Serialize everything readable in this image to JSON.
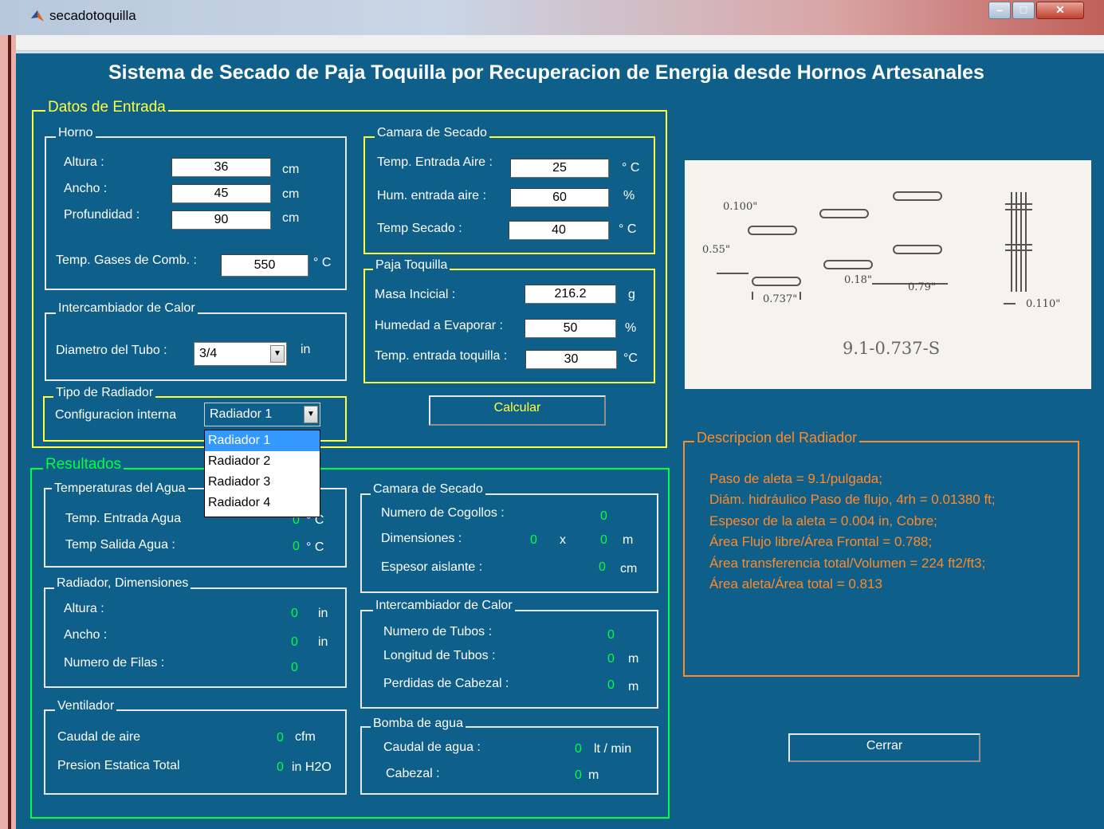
{
  "window": {
    "title": "secadotoquilla"
  },
  "header": {
    "title": "Sistema de Secado de Paja Toquilla por Recuperacion de Energia desde Hornos Artesanales"
  },
  "entrada": {
    "label": "Datos de Entrada",
    "horno": {
      "label": "Horno",
      "altura_label": "Altura :",
      "altura_value": "36",
      "altura_unit": "cm",
      "ancho_label": "Ancho :",
      "ancho_value": "45",
      "ancho_unit": "cm",
      "prof_label": "Profundidad :",
      "prof_value": "90",
      "prof_unit": "cm",
      "gases_label": "Temp. Gases de Comb. :",
      "gases_value": "550",
      "gases_unit": "° C"
    },
    "camara": {
      "label": "Camara de Secado",
      "temp_aire_label": "Temp. Entrada Aire :",
      "temp_aire_value": "25",
      "temp_aire_unit": "° C",
      "hum_label": "Hum. entrada aire :",
      "hum_value": "60",
      "hum_unit": "%",
      "temp_sec_label": "Temp Secado :",
      "temp_sec_value": "40",
      "temp_sec_unit": "° C"
    },
    "intercambiador": {
      "label": "Intercambiador de Calor",
      "diam_label": "Diametro del Tubo :",
      "diam_value": "3/4",
      "diam_unit": "in"
    },
    "paja": {
      "label": "Paja Toquilla",
      "masa_label": "Masa Incicial :",
      "masa_value": "216.2",
      "masa_unit": "g",
      "humedad_label": "Humedad a Evaporar :",
      "humedad_value": "50",
      "humedad_unit": "%",
      "temp_label": "Temp. entrada toquilla :",
      "temp_value": "30",
      "temp_unit": "°C"
    },
    "radiador": {
      "label": "Tipo de Radiador",
      "config_label": "Configuracion interna",
      "selected": "Radiador 1",
      "options": [
        "Radiador 1",
        "Radiador 2",
        "Radiador 3",
        "Radiador 4"
      ]
    },
    "calcular_label": "Calcular"
  },
  "resultados": {
    "label": "Resultados",
    "temp_agua": {
      "label": "Temperaturas del Agua",
      "entrada_label": "Temp. Entrada Agua",
      "entrada_value": "0",
      "entrada_unit": "° C",
      "salida_label": "Temp Salida Agua :",
      "salida_value": "0",
      "salida_unit": "° C"
    },
    "radiador_dim": {
      "label": "Radiador, Dimensiones",
      "altura_label": "Altura :",
      "altura_value": "0",
      "altura_unit": "in",
      "ancho_label": "Ancho :",
      "ancho_value": "0",
      "ancho_unit": "in",
      "filas_label": "Numero de Filas :",
      "filas_value": "0"
    },
    "ventilador": {
      "label": "Ventilador",
      "caudal_label": "Caudal  de aire",
      "caudal_value": "0",
      "caudal_unit": "cfm",
      "presion_label": "Presion Estatica Total",
      "presion_value": "0",
      "presion_unit": "in H2O"
    },
    "camara": {
      "label": "Camara de Secado",
      "cogollos_label": "Numero de Cogollos :",
      "cogollos_value": "0",
      "dim_label": "Dimensiones :",
      "dim_a": "0",
      "dim_x": "x",
      "dim_b": "0",
      "dim_unit": "m",
      "espesor_label": "Espesor aislante :",
      "espesor_value": "0",
      "espesor_unit": "cm"
    },
    "intercambiador": {
      "label": "Intercambiador de Calor",
      "tubos_label": "Numero de Tubos :",
      "tubos_value": "0",
      "longitud_label": "Longitud de Tubos :",
      "longitud_value": "0",
      "longitud_unit": "m",
      "perdidas_label": "Perdidas de Cabezal :",
      "perdidas_value": "0",
      "perdidas_unit": "m"
    },
    "bomba": {
      "label": "Bomba de agua",
      "caudal_label": "Caudal  de agua :",
      "caudal_value": "0",
      "caudal_unit": "lt / min",
      "cabezal_label": "Cabezal :",
      "cabezal_value": "0",
      "cabezal_unit": "m"
    }
  },
  "schematic": {
    "l1": "0.100\"",
    "l2": "0.55\"",
    "l3": "0.18\"",
    "l4": "0.79\"",
    "l5": "0.737\"",
    "l6": "0.110\"",
    "caption": "9.1-0.737-S"
  },
  "descripcion": {
    "label": "Descripcion del Radiador",
    "lines": [
      "Paso de aleta = 9.1/pulgada;",
      "Diám. hidráulico Paso de flujo, 4rh = 0.01380 ft;",
      "Espesor de la aleta = 0.004 in, Cobre;",
      "Área Flujo libre/Área Frontal = 0.788;",
      "Área transferencia total/Volumen = 224 ft2/ft3;",
      "Área aleta/Área total = 0.813"
    ]
  },
  "cerrar_label": "Cerrar",
  "colors": {
    "background": "#0e5f8a",
    "input_frame": "#ffff40",
    "result_frame": "#00ff40",
    "desc_frame": "#ff8a2a",
    "result_text": "#00ff40"
  }
}
